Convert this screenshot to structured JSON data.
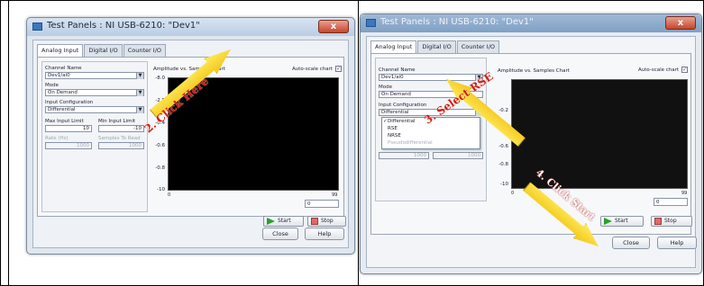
{
  "left_window": {
    "title": "Test Panels : NI USB-6210: \"Dev1\"",
    "close_glyph": "x",
    "tabs": [
      {
        "label": "Analog Input",
        "active": true
      },
      {
        "label": "Digital I/O",
        "active": false
      },
      {
        "label": "Counter I/O",
        "active": false
      }
    ],
    "channel_name_label": "Channel Name",
    "channel_name_value": "Dev1/ai0",
    "mode_label": "Mode",
    "mode_value": "On Demand",
    "input_config_label": "Input Configuration",
    "input_config_value": "Differential",
    "max_input_label": "Max Input Limit",
    "max_input_value": "10",
    "min_input_label": "Min Input Limit",
    "min_input_value": "-10",
    "rate_label": "Rate (Hz)",
    "rate_value": "1000",
    "samples_label": "Samples To Read",
    "samples_value": "1000",
    "chart_title": "Amplitude vs. Samples Chart",
    "autoscale_label": "Auto-scale chart",
    "y_ticks": [
      "-8.0",
      "-2.5",
      "-0.4",
      "-0.6",
      "-0.8",
      "-10"
    ],
    "x_tick_start": "0",
    "x_tick_end": "99",
    "x_value": "0",
    "start_label": "Start",
    "stop_label": "Stop",
    "close_label": "Close",
    "help_label": "Help",
    "callout": "2. Click Here"
  },
  "right_window": {
    "title": "Test Panels : NI USB-6210: \"Dev1\"",
    "close_glyph": "x",
    "tabs": [
      {
        "label": "Analog Input",
        "active": true
      },
      {
        "label": "Digital I/O",
        "active": false
      },
      {
        "label": "Counter I/O",
        "active": false
      }
    ],
    "channel_name_label": "Channel Name",
    "channel_name_value": "Dev1/ai0",
    "mode_label": "Mode",
    "mode_value": "On Demand",
    "input_config_label": "Input Configuration",
    "input_config_value": "Differential",
    "dropdown_options": [
      {
        "label": "Differential",
        "checked": true,
        "disabled": false
      },
      {
        "label": "RSE",
        "checked": false,
        "disabled": false
      },
      {
        "label": "NRSE",
        "checked": false,
        "disabled": false
      },
      {
        "label": "Pseudodifferential",
        "checked": false,
        "disabled": true
      }
    ],
    "rate_value": "1000",
    "samples_value": "1000",
    "chart_title": "Amplitude vs. Samples Chart",
    "autoscale_label": "Auto-scale chart",
    "y_ticks": [
      "-0.2",
      "-0.4",
      "-0.6",
      "-0.8",
      "-10"
    ],
    "x_tick_start": "0",
    "x_tick_end": "99",
    "x_value": "0",
    "start_label": "Start",
    "stop_label": "Stop",
    "close_label": "Close",
    "help_label": "Help",
    "callout_select": "3. Select RSE",
    "callout_start": "4. Click Start"
  },
  "colors": {
    "callout_fill": "#f7d52a",
    "callout_text": "#d41f12",
    "plot_bg": "#000000",
    "start_icon": "#2aa02a",
    "stop_icon": "#e06a6a"
  }
}
